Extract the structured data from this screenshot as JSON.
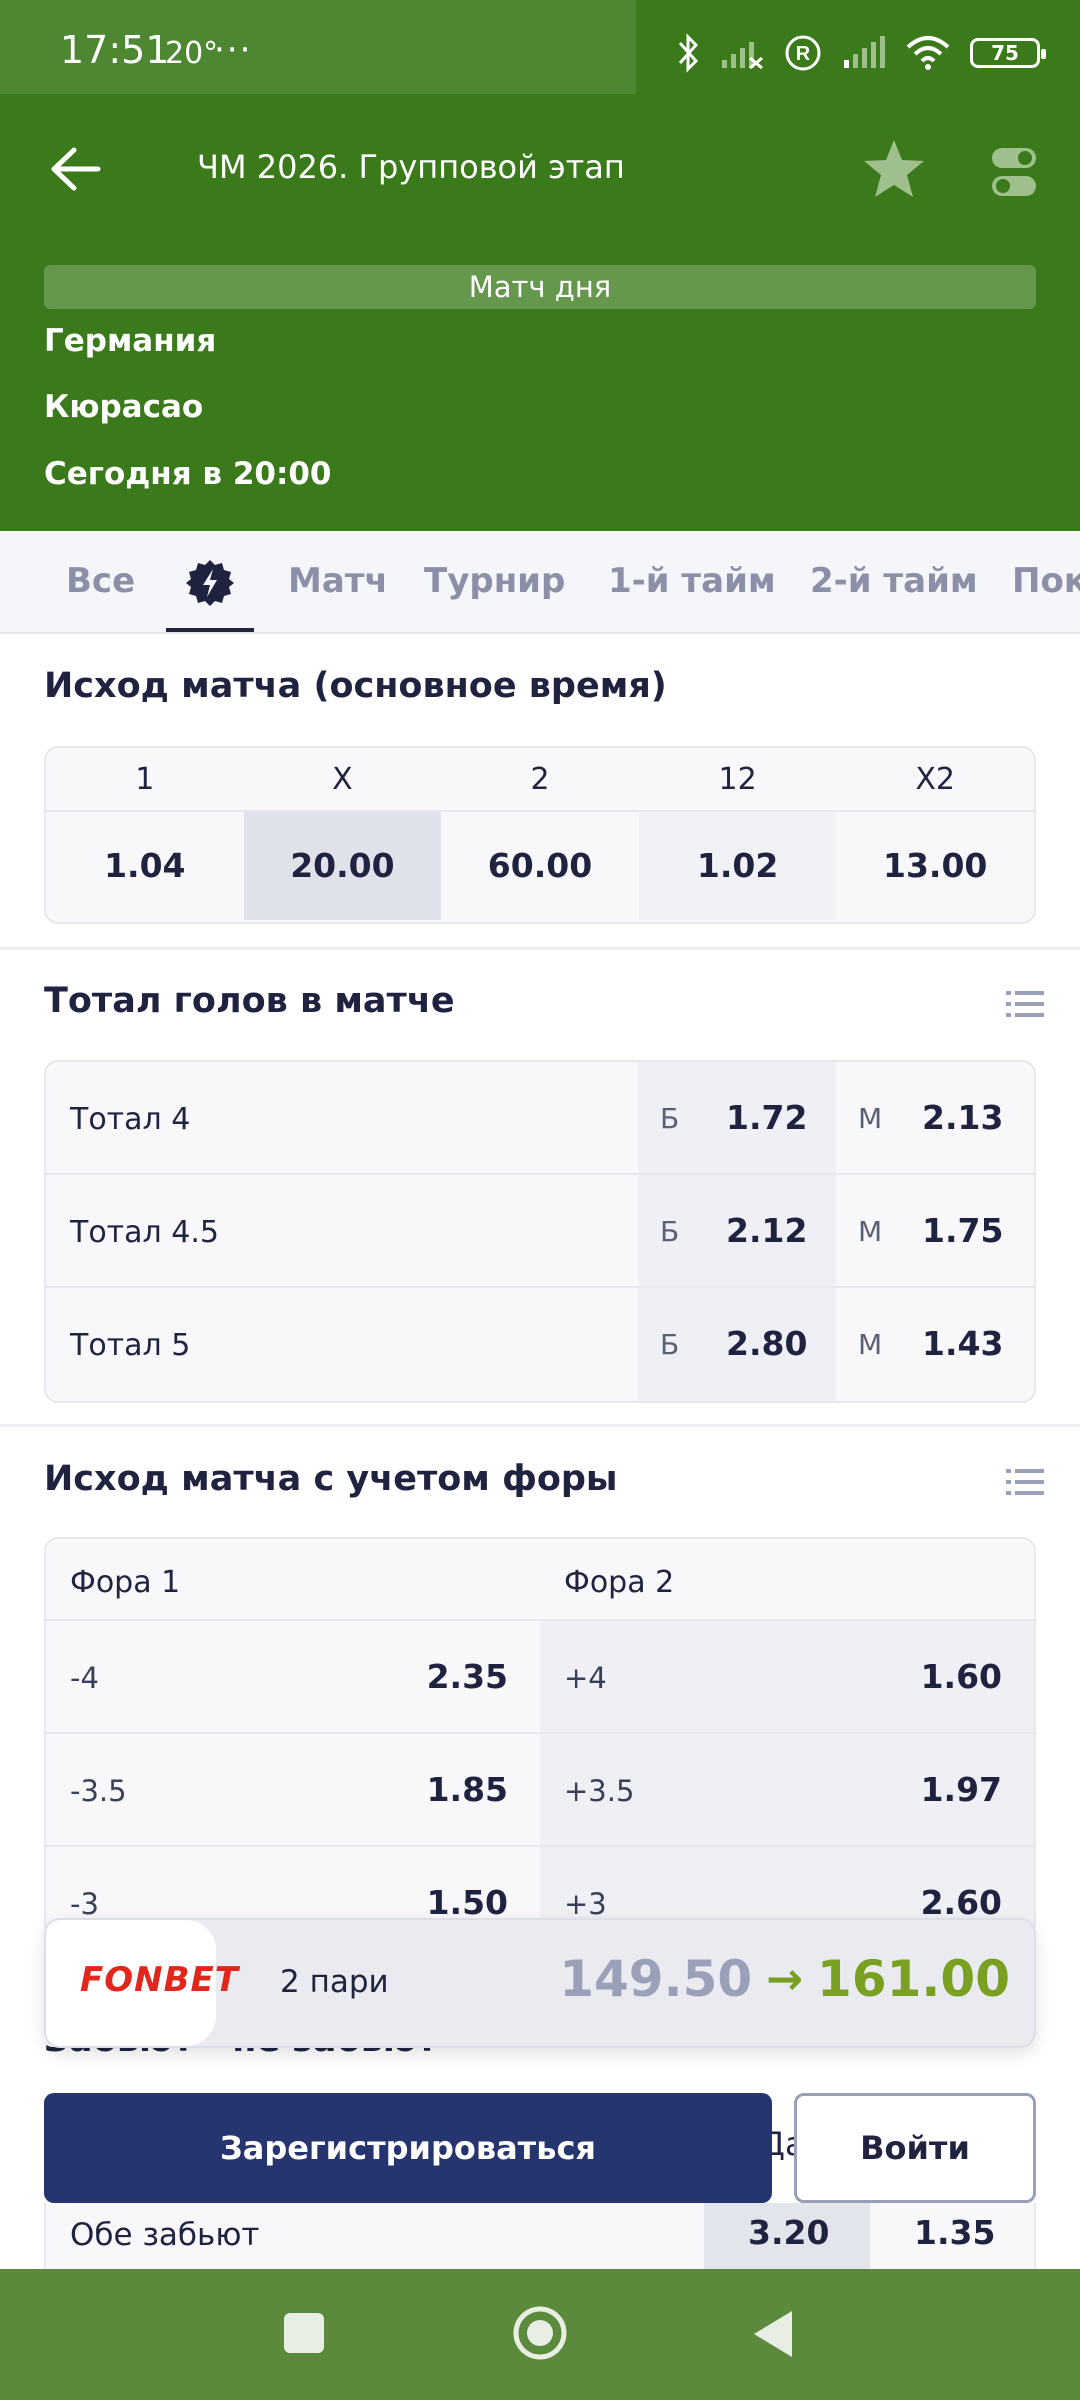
{
  "status": {
    "time": "17:51",
    "temp": "20°",
    "dots": "···",
    "battery": "75"
  },
  "header": {
    "title": "ЧМ 2026. Групповой этап",
    "match_day": "Матч дня",
    "team1": "Германия",
    "team2": "Кюрасао",
    "start": "Сегодня в 20:00"
  },
  "tabs": [
    "Все",
    "Матч",
    "Турнир",
    "1-й тайм",
    "2-й тайм",
    "Пок"
  ],
  "outcome": {
    "title": "Исход матча (основное время)",
    "headers": [
      "1",
      "X",
      "2",
      "12",
      "X2"
    ],
    "values": [
      "1.04",
      "20.00",
      "60.00",
      "1.02",
      "13.00"
    ]
  },
  "totals": {
    "title": "Тотал голов в матче",
    "over_label": "Б",
    "under_label": "М",
    "rows": [
      {
        "label": "Тотал 4",
        "over": "1.72",
        "under": "2.13"
      },
      {
        "label": "Тотал 4.5",
        "over": "2.12",
        "under": "1.75"
      },
      {
        "label": "Тотал 5",
        "over": "2.80",
        "under": "1.43"
      }
    ]
  },
  "handicap": {
    "title": "Исход матча с учетом форы",
    "col1": "Фора 1",
    "col2": "Фора 2",
    "rows": [
      {
        "h1": "-4",
        "v1": "2.35",
        "h2": "+4",
        "v2": "1.60"
      },
      {
        "h1": "-3.5",
        "v1": "1.85",
        "h2": "+3.5",
        "v2": "1.97"
      },
      {
        "h1": "-3",
        "v1": "1.50",
        "h2": "+3",
        "v2": "2.60"
      }
    ]
  },
  "coupon": {
    "logo": "FONBET",
    "count": "2 пари",
    "old_odds": "149.50",
    "arrow": "→",
    "new_odds": "161.00"
  },
  "partial": {
    "section_title": "Забьют - не забьют",
    "da": "Да"
  },
  "buttons": {
    "register": "Зарегистрироваться",
    "login": "Войти"
  },
  "both": {
    "label": "Обе забьют",
    "yes": "3.20",
    "no": "1.35"
  }
}
